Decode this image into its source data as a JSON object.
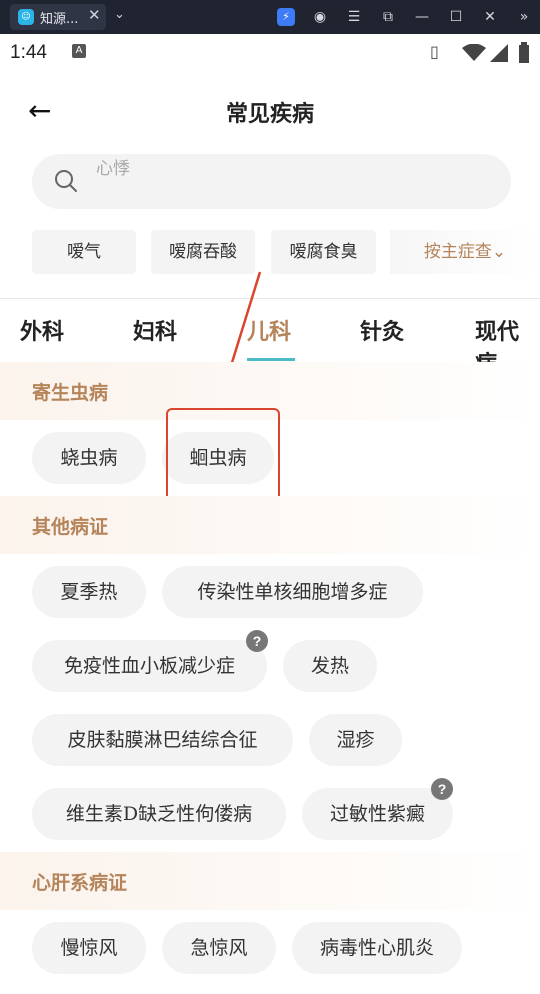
{
  "window": {
    "tab_title": "知源...",
    "close_glyph": "✕",
    "chevron_glyph": "⌄",
    "icons": [
      "bolt-icon",
      "user-icon",
      "menu-icon",
      "screenshot-icon",
      "minimize-icon",
      "maximize-icon",
      "close-icon",
      "more-icon"
    ]
  },
  "status_bar": {
    "time": "1:44",
    "badge": "A"
  },
  "header": {
    "title": "常见疾病",
    "back_glyph": "←"
  },
  "search": {
    "placeholder": "心悸"
  },
  "quick_chips": [
    "嗳气",
    "嗳腐吞酸",
    "嗳腐食臭"
  ],
  "filter": {
    "label": "按主症查",
    "chevron": "⌄"
  },
  "tabs": {
    "items": [
      "外科",
      "妇科",
      "儿科",
      "针灸",
      "现代病"
    ],
    "active_index": 2
  },
  "sections": [
    {
      "title": "寄生虫病",
      "items": [
        "蛲虫病",
        "蛔虫病"
      ]
    },
    {
      "title": "其他病证",
      "items": [
        "夏季热",
        "传染性单核细胞增多症",
        "免疫性血小板减少症",
        "发热",
        "皮肤黏膜淋巴结综合征",
        "湿疹",
        "维生素D缺乏性佝偻病",
        "过敏性紫癜"
      ]
    },
    {
      "title": "心肝系病证",
      "items": [
        "慢惊风",
        "急惊风",
        "病毒性心肌炎"
      ]
    }
  ],
  "badge_text": "?",
  "colors": {
    "accent": "#b5845a",
    "tab_underline": "#4bbcc7",
    "highlight": "#d9452e",
    "pill_bg": "#f3f3f3"
  }
}
